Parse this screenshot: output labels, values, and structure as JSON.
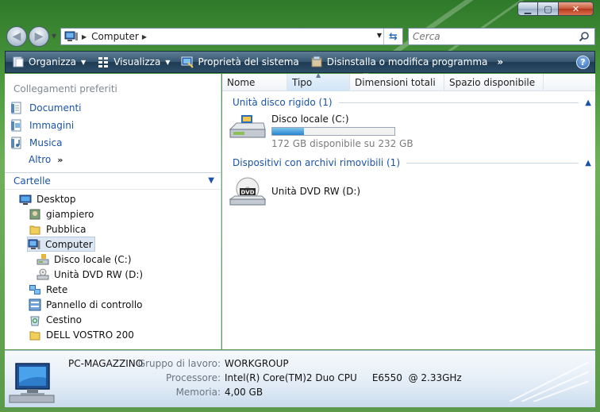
{
  "window": {
    "controls": {
      "minimize_icon": "minimize-icon",
      "maximize_icon": "maximize-icon",
      "close_icon": "close-icon"
    }
  },
  "nav": {
    "address_crumb": "Computer",
    "search_placeholder": "Cerca"
  },
  "toolbar": {
    "organize": "Organizza",
    "view": "Visualizza",
    "system_properties": "Proprietà del sistema",
    "uninstall": "Disinstalla o modifica programma",
    "more": "»",
    "help": "?"
  },
  "favorites": {
    "title": "Collegamenti preferiti",
    "items": [
      {
        "label": "Documenti",
        "icon": "documents-icon"
      },
      {
        "label": "Immagini",
        "icon": "pictures-icon"
      },
      {
        "label": "Musica",
        "icon": "music-icon"
      }
    ],
    "more": "Altro",
    "more_chevron": "»"
  },
  "folders": {
    "title": "Cartelle",
    "tree": [
      {
        "label": "Desktop",
        "icon": "desktop-icon",
        "level": 0
      },
      {
        "label": "giampiero",
        "icon": "user-folder-icon",
        "level": 1
      },
      {
        "label": "Pubblica",
        "icon": "folder-icon",
        "level": 1
      },
      {
        "label": "Computer",
        "icon": "computer-icon",
        "level": 1,
        "selected": true
      },
      {
        "label": "Disco locale (C:)",
        "icon": "hard-drive-icon",
        "level": 2
      },
      {
        "label": "Unità DVD RW (D:)",
        "icon": "dvd-drive-icon",
        "level": 2
      },
      {
        "label": "Rete",
        "icon": "network-icon",
        "level": 1
      },
      {
        "label": "Pannello di controllo",
        "icon": "control-panel-icon",
        "level": 1
      },
      {
        "label": "Cestino",
        "icon": "recycle-bin-icon",
        "level": 1
      },
      {
        "label": "DELL VOSTRO 200",
        "icon": "folder-icon",
        "level": 1
      }
    ]
  },
  "columns": [
    "Nome",
    "Tipo",
    "Dimensioni totali",
    "Spazio disponibile"
  ],
  "groups": {
    "hard_disks": {
      "title": "Unità disco rigido (1)",
      "drive_name": "Disco locale (C:)",
      "free_text": "172 GB disponibile su 232 GB",
      "used_fraction": 0.26
    },
    "removable": {
      "title": "Dispositivi con archivi rimovibili (1)",
      "drive_name": "Unità DVD RW (D:)",
      "dvd_label": "DVD"
    }
  },
  "details": {
    "computer_name": "PC-MAGAZZINO",
    "workgroup_label": "Gruppo di lavoro:",
    "workgroup_value": "WORKGROUP",
    "processor_label": "Processore:",
    "processor_value": "Intel(R) Core(TM)2 Duo CPU     E6550  @ 2.33GHz",
    "memory_label": "Memoria:",
    "memory_value": "4,00 GB"
  }
}
